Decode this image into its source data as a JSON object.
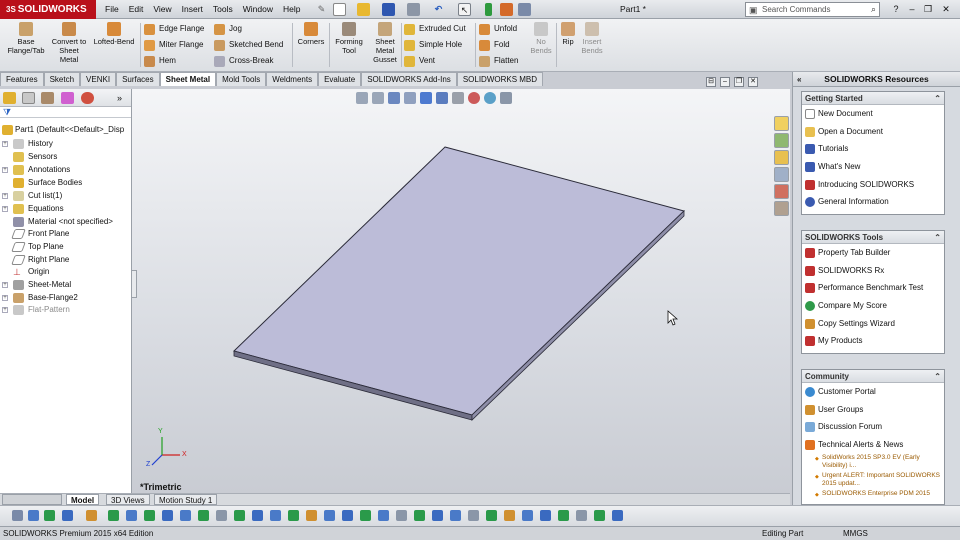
{
  "app": {
    "brand": "SOLIDWORKS",
    "brand_prefix": "3S",
    "document_title": "Part1 *"
  },
  "menu": [
    "File",
    "Edit",
    "View",
    "Insert",
    "Tools",
    "Window",
    "Help"
  ],
  "search": {
    "placeholder": "Search Commands"
  },
  "ribbon": {
    "base_flange": "Base Flange/Tab",
    "convert_sheet": "Convert to Sheet Metal",
    "lofted_bend": "Lofted-Bend",
    "edge_flange": "Edge Flange",
    "miter_flange": "Miter Flange",
    "hem": "Hem",
    "jog": "Jog",
    "sketched_bend": "Sketched Bend",
    "cross_break": "Cross-Break",
    "corners": "Corners",
    "forming_tool": "Forming Tool",
    "sheet_metal_gusset": "Sheet Metal Gusset",
    "extruded_cut": "Extruded Cut",
    "simple_hole": "Simple Hole",
    "vent": "Vent",
    "unfold": "Unfold",
    "fold": "Fold",
    "flatten": "Flatten",
    "no_bends": "No Bends",
    "rip": "Rip",
    "insert_bends": "Insert Bends"
  },
  "tabs": [
    "Features",
    "Sketch",
    "VENKI",
    "Surfaces",
    "Sheet Metal",
    "Mold Tools",
    "Weldments",
    "Evaluate",
    "SOLIDWORKS Add-Ins",
    "SOLIDWORKS MBD"
  ],
  "active_tab": "Sheet Metal",
  "tree": {
    "root": "Part1  (Default<<Default>_Disp",
    "items": [
      "History",
      "Sensors",
      "Annotations",
      "Surface Bodies",
      "Cut list(1)",
      "Equations",
      "Material <not specified>",
      "Front Plane",
      "Top Plane",
      "Right Plane",
      "Origin",
      "Sheet-Metal",
      "Base-Flange2",
      "Flat-Pattern"
    ]
  },
  "view": {
    "orientation": "*Trimetric",
    "triad": {
      "x": "X",
      "y": "Y",
      "z": "Z"
    }
  },
  "model_tabs": [
    "Model",
    "3D Views",
    "Motion Study 1"
  ],
  "resources": {
    "title": "SOLIDWORKS Resources",
    "getting_started": {
      "title": "Getting Started",
      "items": [
        "New Document",
        "Open a Document",
        "Tutorials",
        "What's New",
        "Introducing SOLIDWORKS",
        "General Information"
      ]
    },
    "tools": {
      "title": "SOLIDWORKS Tools",
      "items": [
        "Property Tab Builder",
        "SOLIDWORKS Rx",
        "Performance Benchmark Test",
        "Compare My Score",
        "Copy Settings Wizard",
        "My Products"
      ]
    },
    "community": {
      "title": "Community",
      "items": [
        "Customer Portal",
        "User Groups",
        "Discussion Forum",
        "Technical Alerts & News"
      ],
      "news": [
        "SolidWorks 2015 SP3.0 EV (Early Visibility) i...",
        "Urgent ALERT: Important SOLIDWORKS 2015 updat...",
        "SOLIDWORKS Enterprise PDM 2015"
      ]
    }
  },
  "status": {
    "product": "SOLIDWORKS Premium 2015 x64 Edition",
    "mode": "Editing Part",
    "units": "MMGS"
  },
  "colors": {
    "brand_red": "#b9101a",
    "part_face": "#bcbcd8",
    "part_edge": "#2a2a38"
  }
}
